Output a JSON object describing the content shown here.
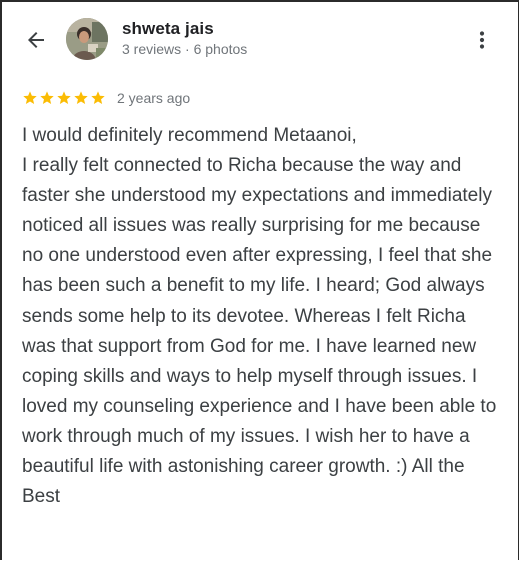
{
  "header": {
    "back_icon": "arrow-back-icon",
    "avatar_icon": "user-avatar",
    "author_name": "shweta jais",
    "author_meta": "3 reviews · 6 photos",
    "more_icon": "more-vert-icon"
  },
  "review": {
    "rating": 5,
    "rating_max": 5,
    "star_color": "#fbbc04",
    "time": "2 years ago",
    "text": "I would definitely recommend Metaanoi,\nI really felt connected to Richa because the way and faster she understood my expectations and immediately noticed all issues was really surprising for me because no one understood even after expressing, I feel that she has been such a benefit to my life. I heard; God always sends some help to its devotee. Whereas I felt Richa was that support from God for me. I have learned new coping skills and ways to help myself through issues. I loved my counseling experience and I have been able to work through much of my issues. I wish her to have a beautiful life with astonishing career growth. :) All the Best"
  }
}
